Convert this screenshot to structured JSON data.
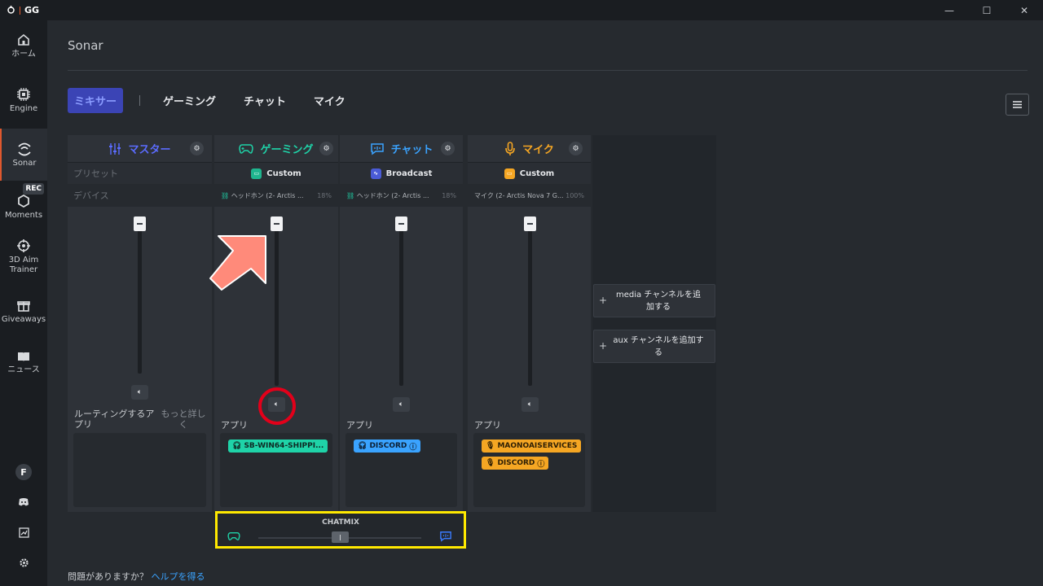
{
  "titlebar": {
    "app_name": "GG",
    "minimize": "—",
    "maximize": "☐",
    "close": "✕"
  },
  "sidebar": {
    "items": [
      {
        "label": "ホーム",
        "icon": "home-icon"
      },
      {
        "label": "Engine",
        "icon": "chip-icon"
      },
      {
        "label": "Sonar",
        "icon": "sonar-icon"
      },
      {
        "label": "Moments",
        "icon": "hexagon-icon",
        "badge": "REC"
      },
      {
        "label": "3D Aim Trainer",
        "icon": "target-icon"
      },
      {
        "label": "Giveaways",
        "icon": "gift-icon"
      },
      {
        "label": "ニュース",
        "icon": "book-icon"
      }
    ],
    "avatar": "F",
    "bottom_icons": [
      "discord-icon",
      "chart-icon",
      "settings-icon"
    ]
  },
  "page": {
    "title": "Sonar"
  },
  "tabs": [
    {
      "label": "ミキサー",
      "active": true
    },
    {
      "label": "ゲーミング",
      "active": false
    },
    {
      "label": "チャット",
      "active": false
    },
    {
      "label": "マイク",
      "active": false
    }
  ],
  "columns": {
    "master": {
      "title": "マスター",
      "color": "#5b6cff",
      "preset_label": "プリセット",
      "device_label": "デバイス",
      "routing_label": "ルーティングするアプリ",
      "more_label": "もっと詳しく"
    },
    "gaming": {
      "title": "ゲーミング",
      "color": "#1fd3a8",
      "preset": "Custom",
      "device": "ヘッドホン (2- Arctis ...",
      "percent": "18%",
      "apps_label": "アプリ",
      "apps": [
        "SB-WIN64-SHIPPI..."
      ]
    },
    "chat": {
      "title": "チャット",
      "color": "#3aa3ff",
      "preset": "Broadcast",
      "device": "ヘッドホン (2- Arctis ...",
      "percent": "18%",
      "apps_label": "アプリ",
      "apps": [
        "DISCORD"
      ]
    },
    "mic": {
      "title": "マイク",
      "color": "#f5a623",
      "preset": "Custom",
      "device": "マイク (2- Arctis Nova 7 G...",
      "percent": "100%",
      "apps_label": "アプリ",
      "apps": [
        "MAONOAISERVICES",
        "DISCORD"
      ]
    }
  },
  "add_channels": {
    "media": "media チャンネルを追加する",
    "aux": "aux チャンネルを追加する"
  },
  "chatmix": {
    "title": "CHATMIX",
    "balance": 0.5
  },
  "help": {
    "question": "問題がありますか？",
    "link": "ヘルプを得る"
  },
  "colors": {
    "accent": "#3b44b5",
    "highlight_box": "#ffe900",
    "annotation_ring": "#e2001a",
    "annotation_arrow": "#ff8a7a"
  }
}
